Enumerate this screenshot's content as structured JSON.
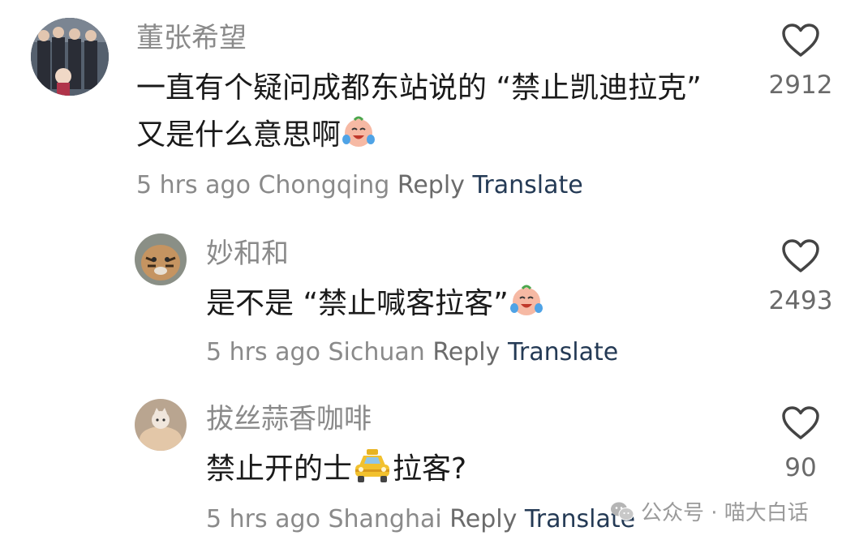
{
  "comments": [
    {
      "username": "董张希望",
      "text_line1": "一直有个疑问成都东站说的 “禁止凯迪拉克”",
      "text_line2": "又是什么意思啊",
      "time": "5 hrs ago",
      "location": "Chongqing",
      "reply_label": "Reply",
      "translate_label": "Translate",
      "likes": "2912"
    },
    {
      "username": "妙和和",
      "text_line1": "是不是 “禁止喊客拉客”",
      "time": "5 hrs ago",
      "location": "Sichuan",
      "reply_label": "Reply",
      "translate_label": "Translate",
      "likes": "2493"
    },
    {
      "username": "拔丝蒜香咖啡",
      "text_before_emoji": "禁止开的士",
      "text_after_emoji": "拉客?",
      "time": "5 hrs ago",
      "location": "Shanghai",
      "reply_label": "Reply",
      "translate_label": "Translate",
      "likes": "90"
    }
  ],
  "watermark": {
    "text": "公众号 · 喵大白话"
  },
  "icons": {
    "like": "heart-outline-icon",
    "laugh_cry": "laughing-crying-face-emoji",
    "taxi": "taxi-emoji",
    "wechat": "wechat-logo-icon"
  },
  "colors": {
    "username": "#8a8a8a",
    "body": "#1a1a1a",
    "translate": "#243a55",
    "like_count": "#6a6a6a"
  }
}
